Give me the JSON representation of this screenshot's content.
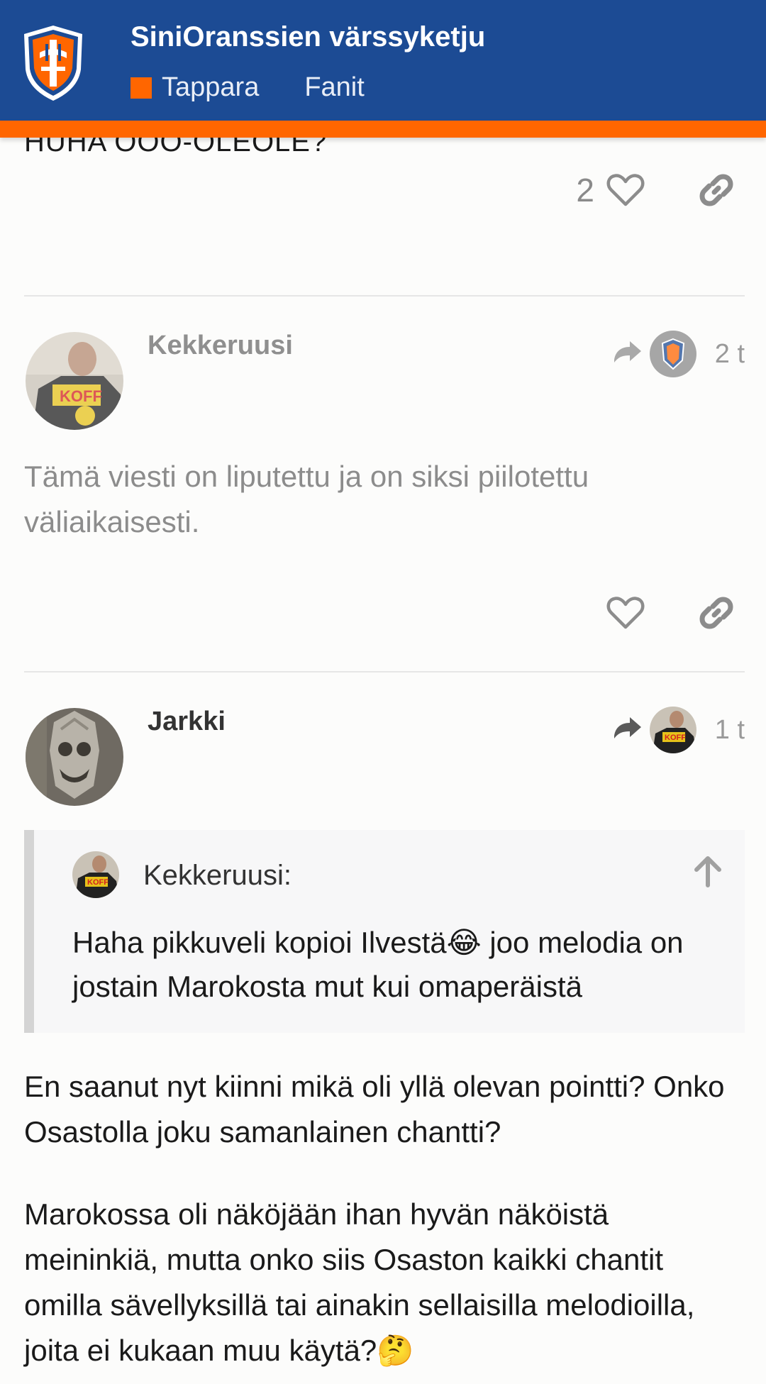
{
  "header": {
    "title": "SiniOranssien värssyketju",
    "categories": [
      "Tappara",
      "Fanit"
    ],
    "accent": "#ff6600",
    "bar_color": "#1c4b94"
  },
  "post_top": {
    "truncated_text": "HUHA OOO-OLEOLE?",
    "like_count": "2"
  },
  "post_kekkeruusi": {
    "username": "Kekkeruusi",
    "age": "2 t",
    "flagged_message": "Tämä viesti on liputettu ja on siksi piilotettu väliaikaisesti."
  },
  "post_jarkki": {
    "username": "Jarkki",
    "age": "1 t",
    "quote": {
      "username": "Kekkeruusi:",
      "text": "Haha pikkuveli kopioi Ilvestä😂 joo melodia on jostain Marokosta mut kui omaperäistä"
    },
    "paragraph_1": "En saanut nyt kiinni mikä oli yllä olevan pointti? Onko Osastolla joku samanlainen chantti?",
    "paragraph_2": "Marokossa oli näköjään ihan hyvän näköistä meininkiä, mutta onko siis Osaston kaikki chantit omilla sävellyksillä tai ainakin sellaisilla melodioilla, joita ei kukaan muu käytä?🤔"
  },
  "icons": {
    "like": "heart-icon",
    "link": "link-icon",
    "reply_to": "reply-arrow-icon",
    "jump_up": "arrow-up-icon"
  }
}
